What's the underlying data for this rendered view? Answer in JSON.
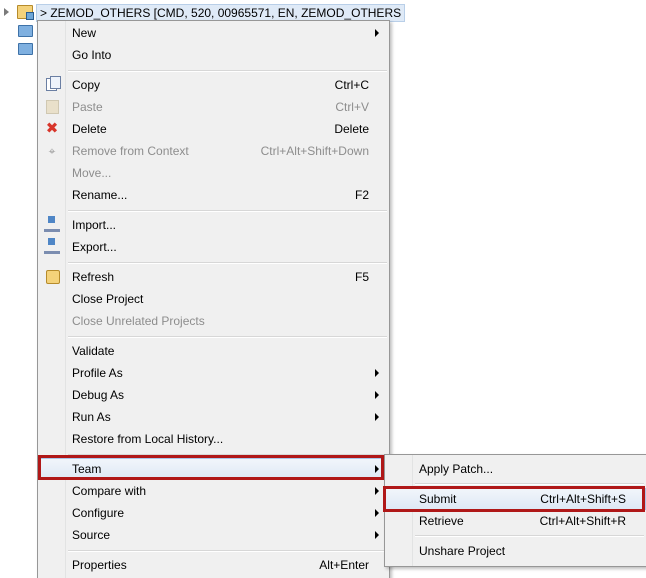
{
  "tree": {
    "project_label": "> ZEMOD_OTHERS [CMD, 520, 00965571, EN, ZEMOD_OTHERS"
  },
  "context_menu": {
    "items": [
      {
        "label": "New",
        "submenu": true
      },
      {
        "label": "Go Into"
      },
      {
        "label": "Copy",
        "shortcut": "Ctrl+C",
        "icon": "copy-icon"
      },
      {
        "label": "Paste",
        "shortcut": "Ctrl+V",
        "icon": "paste-icon",
        "disabled": true
      },
      {
        "label": "Delete",
        "shortcut": "Delete",
        "icon": "delete-icon"
      },
      {
        "label": "Remove from Context",
        "shortcut": "Ctrl+Alt+Shift+Down",
        "icon": "remove-context-icon",
        "disabled": true
      },
      {
        "label": "Move...",
        "disabled": true
      },
      {
        "label": "Rename...",
        "shortcut": "F2"
      },
      {
        "label": "Import...",
        "icon": "import-icon"
      },
      {
        "label": "Export...",
        "icon": "export-icon"
      },
      {
        "label": "Refresh",
        "shortcut": "F5",
        "icon": "refresh-icon"
      },
      {
        "label": "Close Project"
      },
      {
        "label": "Close Unrelated Projects",
        "disabled": true
      },
      {
        "label": "Validate"
      },
      {
        "label": "Profile As",
        "submenu": true
      },
      {
        "label": "Debug As",
        "submenu": true
      },
      {
        "label": "Run As",
        "submenu": true
      },
      {
        "label": "Restore from Local History..."
      },
      {
        "label": "Team",
        "submenu": true,
        "highlighted": true
      },
      {
        "label": "Compare with",
        "submenu": true
      },
      {
        "label": "Configure",
        "submenu": true
      },
      {
        "label": "Source",
        "submenu": true
      },
      {
        "label": "Properties",
        "shortcut": "Alt+Enter"
      }
    ]
  },
  "team_submenu": {
    "items": [
      {
        "label": "Apply Patch..."
      },
      {
        "label": "Submit",
        "shortcut": "Ctrl+Alt+Shift+S",
        "highlighted": true
      },
      {
        "label": "Retrieve",
        "shortcut": "Ctrl+Alt+Shift+R"
      },
      {
        "label": "Unshare Project"
      }
    ]
  },
  "colors": {
    "highlight_box": "#b01818",
    "menu_background": "#f0f0f0",
    "disabled_text": "#8d8d8d"
  }
}
